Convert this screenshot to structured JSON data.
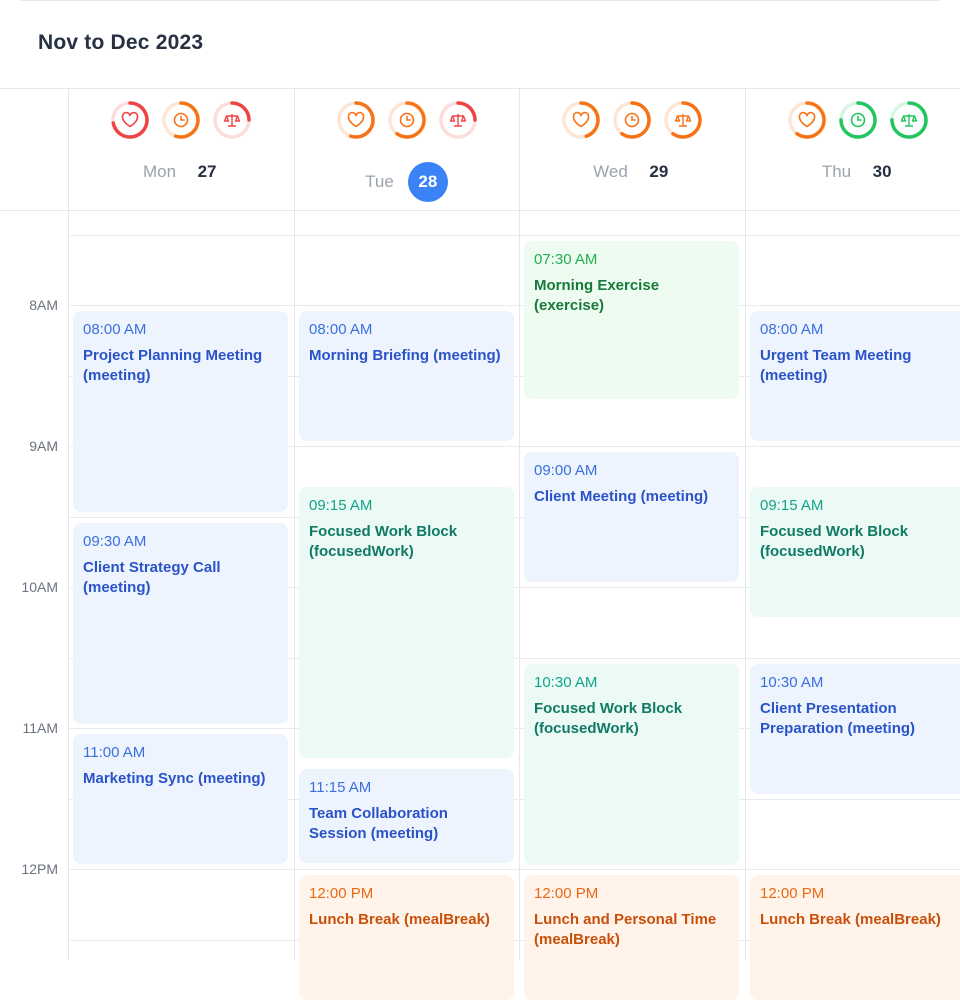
{
  "header": {
    "range_title": "Nov to Dec 2023"
  },
  "colors": {
    "health": "#ef4444",
    "time": "#f97316",
    "balance": "#22c55e",
    "today_accent": "#3b82f6",
    "meeting": "#2a53c8",
    "focus": "#117a64",
    "exercise": "#177a3a",
    "meal": "#c9500a"
  },
  "hours": [
    "8AM",
    "9AM",
    "10AM",
    "11AM",
    "12PM"
  ],
  "days": [
    {
      "weekday": "Mon",
      "date": "27",
      "today": false,
      "indicators": [
        {
          "icon": "heart-icon",
          "color": "#ef4444",
          "level": 0.72
        },
        {
          "icon": "clock-icon",
          "color": "#f97316",
          "level": 0.55
        },
        {
          "icon": "scale-icon",
          "color": "#ef4444",
          "level": 0.25
        }
      ],
      "events": [
        {
          "time": "08:00 AM",
          "title": "Project Planning Meeting (meeting)",
          "category": "meeting"
        },
        {
          "time": "09:30 AM",
          "title": "Client Strategy Call (meeting)",
          "category": "meeting"
        },
        {
          "time": "11:00 AM",
          "title": "Marketing Sync (meeting)",
          "category": "meeting"
        }
      ]
    },
    {
      "weekday": "Tue",
      "date": "28",
      "today": true,
      "indicators": [
        {
          "icon": "heart-icon",
          "color": "#f97316",
          "level": 0.55
        },
        {
          "icon": "clock-icon",
          "color": "#f97316",
          "level": 0.6
        },
        {
          "icon": "scale-icon",
          "color": "#ef4444",
          "level": 0.25
        }
      ],
      "events": [
        {
          "time": "08:00 AM",
          "title": "Morning Briefing (meeting)",
          "category": "meeting"
        },
        {
          "time": "09:15 AM",
          "title": "Focused Work Block (focusedWork)",
          "category": "focus"
        },
        {
          "time": "11:15 AM",
          "title": "Team Collaboration Session (meeting)",
          "category": "meeting"
        },
        {
          "time": "12:00 PM",
          "title": "Lunch Break (mealBreak)",
          "category": "meal"
        }
      ]
    },
    {
      "weekday": "Wed",
      "date": "29",
      "today": false,
      "indicators": [
        {
          "icon": "heart-icon",
          "color": "#f97316",
          "level": 0.45
        },
        {
          "icon": "clock-icon",
          "color": "#f97316",
          "level": 0.6
        },
        {
          "icon": "scale-icon",
          "color": "#f97316",
          "level": 0.6
        }
      ],
      "events": [
        {
          "time": "07:30 AM",
          "title": "Morning Exercise (exercise)",
          "category": "exercise"
        },
        {
          "time": "09:00 AM",
          "title": "Client Meeting (meeting)",
          "category": "meeting"
        },
        {
          "time": "10:30 AM",
          "title": "Focused Work Block (focusedWork)",
          "category": "focus"
        },
        {
          "time": "12:00 PM",
          "title": "Lunch and Personal Time (mealBreak)",
          "category": "meal"
        }
      ]
    },
    {
      "weekday": "Thu",
      "date": "30",
      "today": false,
      "indicators": [
        {
          "icon": "heart-icon",
          "color": "#f97316",
          "level": 0.6
        },
        {
          "icon": "clock-icon",
          "color": "#22c55e",
          "level": 0.75
        },
        {
          "icon": "scale-icon",
          "color": "#22c55e",
          "level": 0.75
        }
      ],
      "events": [
        {
          "time": "08:00 AM",
          "title": "Urgent Team Meeting (meeting)",
          "category": "meeting"
        },
        {
          "time": "09:15 AM",
          "title": "Focused Work Block (focusedWork)",
          "category": "focus"
        },
        {
          "time": "10:30 AM",
          "title": "Client Presentation Preparation (meeting)",
          "category": "meeting"
        },
        {
          "time": "12:00 PM",
          "title": "Lunch Break (mealBreak)",
          "category": "meal"
        }
      ]
    }
  ]
}
